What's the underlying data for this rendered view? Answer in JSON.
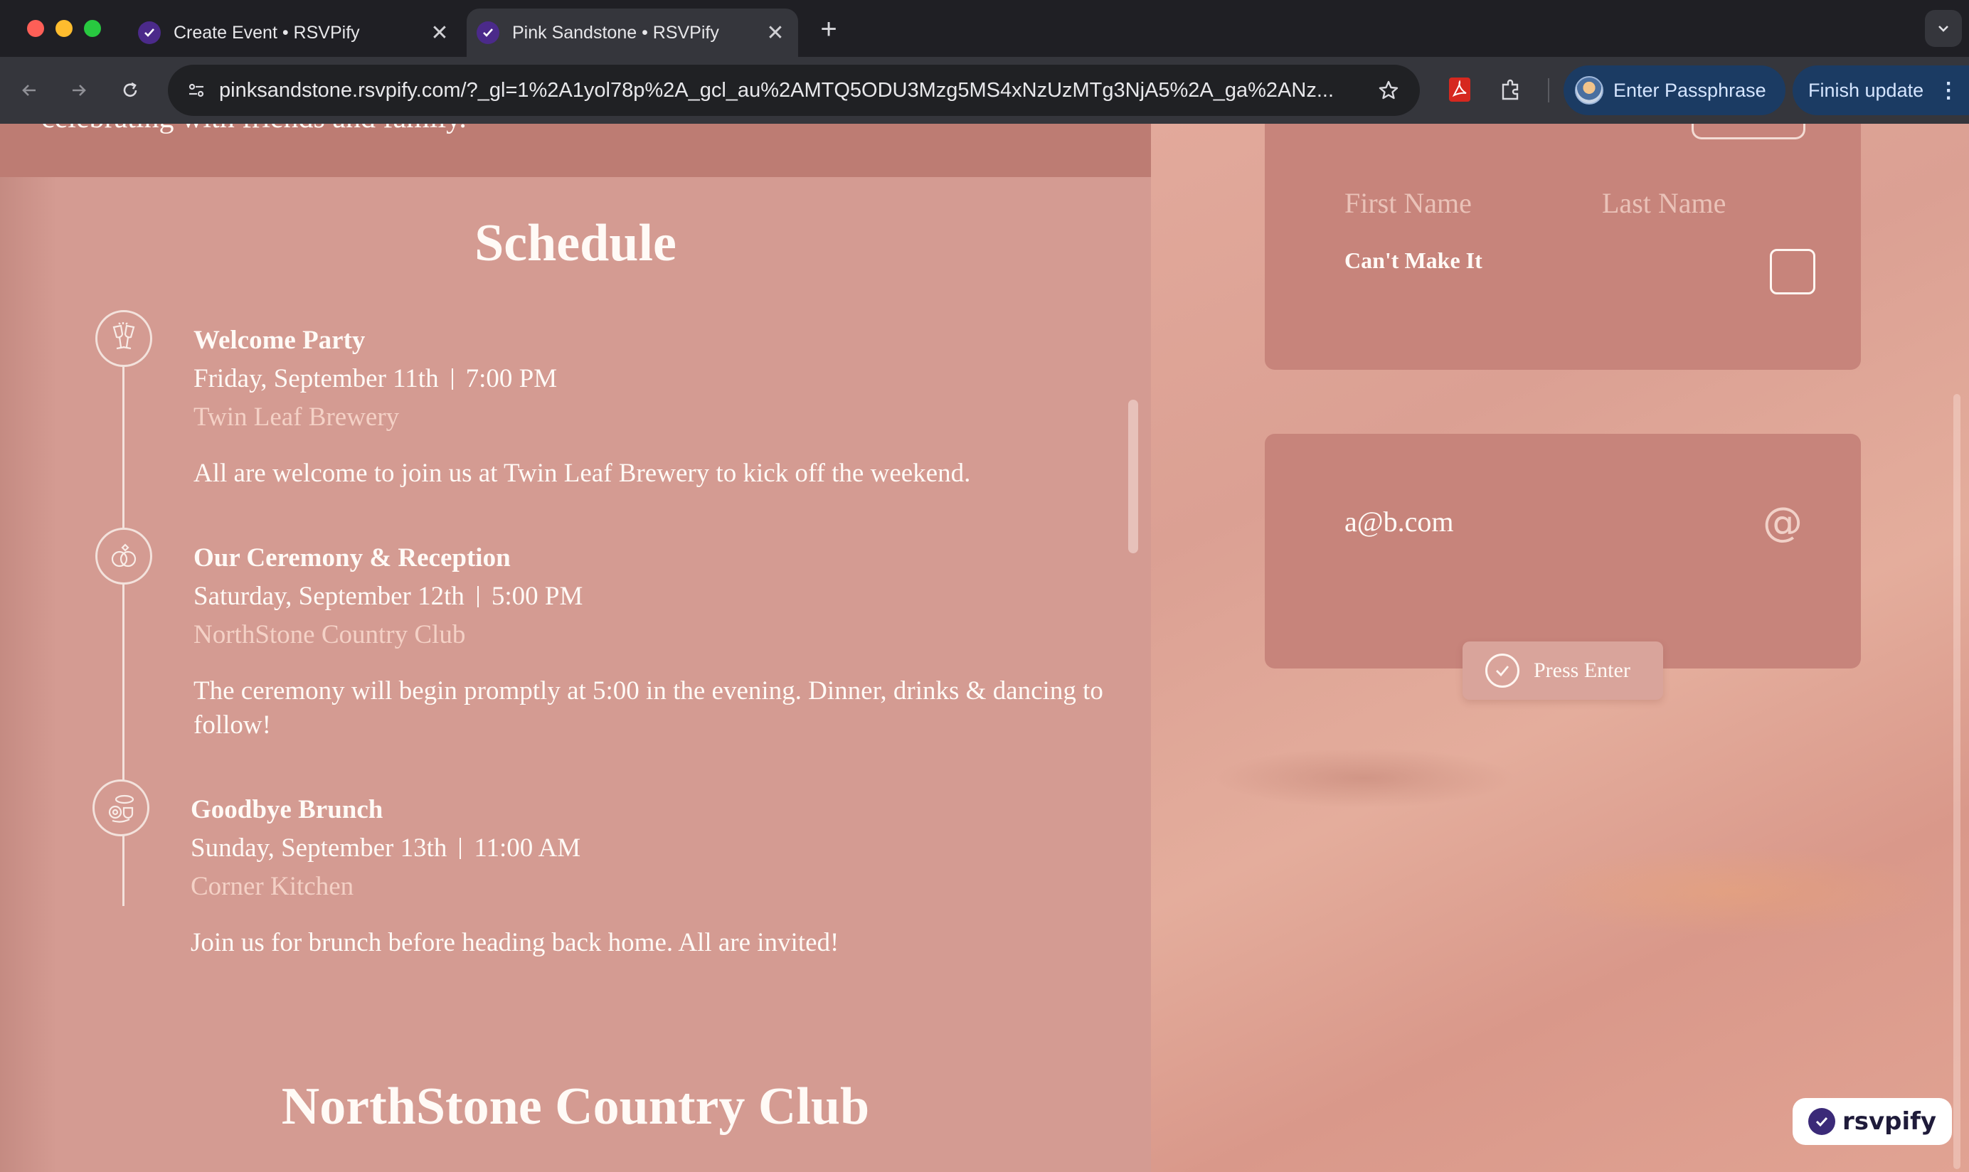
{
  "browser": {
    "tabs": [
      {
        "title": "Create Event • RSVPify",
        "close": "✕"
      },
      {
        "title": "Pink Sandstone • RSVPify",
        "close": "✕"
      }
    ],
    "new_tab": "+",
    "url": "pinksandstone.rsvpify.com/?_gl=1%2A1yol78p%2A_gcl_au%2AMTQ5ODU3Mzg5MS4xNzUzMTg3NjA5%2A_ga%2ANz...",
    "profile_button": "Enter Passphrase",
    "update_button": "Finish update",
    "update_menu": "⋮"
  },
  "intro": {
    "cut_text": "celebrating with friends and family."
  },
  "schedule": {
    "title": "Schedule",
    "events": [
      {
        "name": "Welcome Party",
        "date": "Friday, September 11th",
        "time": "7:00 PM",
        "venue": "Twin Leaf Brewery",
        "description": "All are welcome to join us at Twin Leaf Brewery to kick off the weekend.",
        "icon": "cheers-glasses-icon"
      },
      {
        "name": "Our Ceremony & Reception",
        "date": "Saturday, September 12th",
        "time": "5:00 PM",
        "venue": "NorthStone Country Club",
        "description": "The ceremony will begin promptly at 5:00 in the evening. Dinner, drinks & dancing to follow!",
        "icon": "wedding-rings-icon"
      },
      {
        "name": "Goodbye Brunch",
        "date": "Sunday, September 13th",
        "time": "11:00 AM",
        "venue": "Corner Kitchen",
        "description": "Join us for brunch before heading back home. All are invited!",
        "icon": "brunch-icon"
      }
    ]
  },
  "venue_title": "NorthStone Country Club",
  "rsvp": {
    "first_name_placeholder": "First Name",
    "last_name_placeholder": "Last Name",
    "cant_make_it": "Can't Make It",
    "email_value": "a@b.com",
    "at_symbol": "@",
    "press_enter": "Press Enter"
  },
  "badge": {
    "label": "rsvpify"
  },
  "colors": {
    "page_pink": "#d49b92",
    "card": "#c7847b",
    "chrome_bg": "#1f1f24",
    "brand_purple": "#3b2a78"
  }
}
